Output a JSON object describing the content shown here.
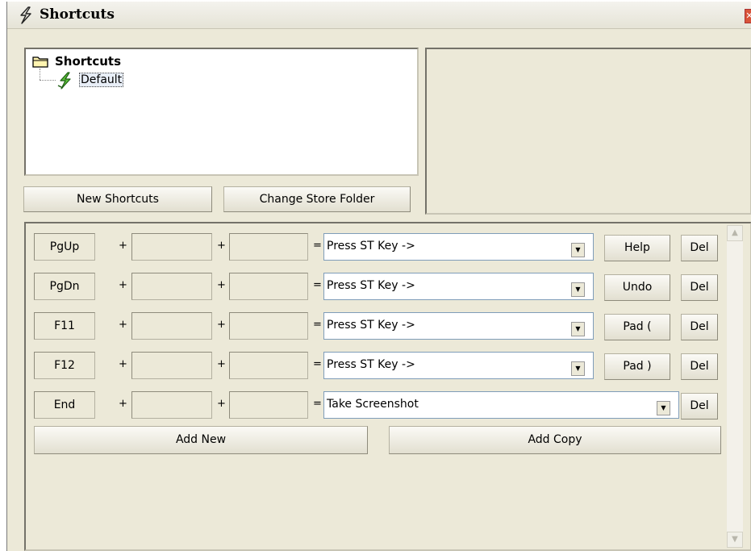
{
  "window": {
    "title": "Shortcuts",
    "close_glyph": "✕",
    "title_icon": "lightning-icon"
  },
  "tree": {
    "root_label": "Shortcuts",
    "root_icon": "folder-icon",
    "child_label": "Default",
    "child_icon": "shortcut-set-icon"
  },
  "buttons": {
    "new_shortcuts": "New Shortcuts",
    "change_store_folder": "Change Store Folder",
    "add_new": "Add New",
    "add_copy": "Add Copy"
  },
  "rows": [
    {
      "key1": "PgUp",
      "key2": "",
      "key3": "",
      "action": "Press ST Key ->",
      "func": "Help",
      "del": "Del"
    },
    {
      "key1": "PgDn",
      "key2": "",
      "key3": "",
      "action": "Press ST Key ->",
      "func": "Undo",
      "del": "Del"
    },
    {
      "key1": "F11",
      "key2": "",
      "key3": "",
      "action": "Press ST Key ->",
      "func": "Pad (",
      "del": "Del"
    },
    {
      "key1": "F12",
      "key2": "",
      "key3": "",
      "action": "Press ST Key ->",
      "func": "Pad )",
      "del": "Del"
    },
    {
      "key1": "End",
      "key2": "",
      "key3": "",
      "action": "Take Screenshot",
      "func": "",
      "del": "Del"
    }
  ],
  "symbols": {
    "plus": "+",
    "equals": "=",
    "dropdown": "▼",
    "scroll_up": "▲",
    "scroll_down": "▼"
  },
  "colors": {
    "window_bg": "#ece9d8",
    "close_red": "#d9543a",
    "icon_green": "#3a9a2a"
  }
}
